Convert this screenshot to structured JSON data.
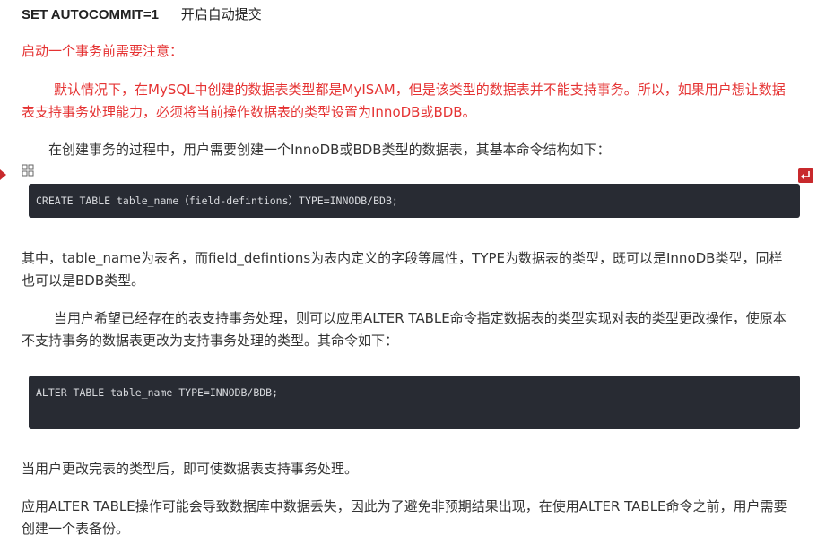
{
  "line1": {
    "command": "SET AUTOCOMMIT=1",
    "desc": "开启自动提交"
  },
  "notice_heading": "启动一个事务前需要注意：",
  "notice_body": "默认情况下，在MySQL中创建的数据表类型都是MyISAM，但是该类型的数据表并不能支持事务。所以，如果用户想让数据表支持事务处理能力，必须将当前操作数据表的类型设置为InnoDB或BDB。",
  "create_intro": "在创建事务的过程中，用户需要创建一个InnoDB或BDB类型的数据表，其基本命令结构如下：",
  "code1": "CREATE TABLE table_name（field-defintions）TYPE=INNODB/BDB;",
  "explain": "其中，table_name为表名，而field_defintions为表内定义的字段等属性，TYPE为数据表的类型，既可以是InnoDB类型，同样也可以是BDB类型。",
  "alter_intro": "当用户希望已经存在的表支持事务处理，则可以应用ALTER TABLE命令指定数据表的类型实现对表的类型更改操作，使原本不支持事务的数据表更改为支持事务处理的类型。其命令如下：",
  "code2": "ALTER TABLE table_name TYPE=INNODB/BDB;",
  "after_alter": "当用户更改完表的类型后，即可使数据表支持事务处理。",
  "warning": "应用ALTER TABLE操作可能会导致数据库中数据丢失，因此为了避免非预期结果出现，在使用ALTER TABLE命令之前，用户需要创建一个表备份。",
  "colors": {
    "red_text": "#e53333",
    "code_bg": "#282b33",
    "marker": "#c8292c"
  },
  "icons": {
    "left_marker": "triangle-marker-icon",
    "grid": "expand-grid-icon",
    "return": "return-arrow-icon"
  }
}
